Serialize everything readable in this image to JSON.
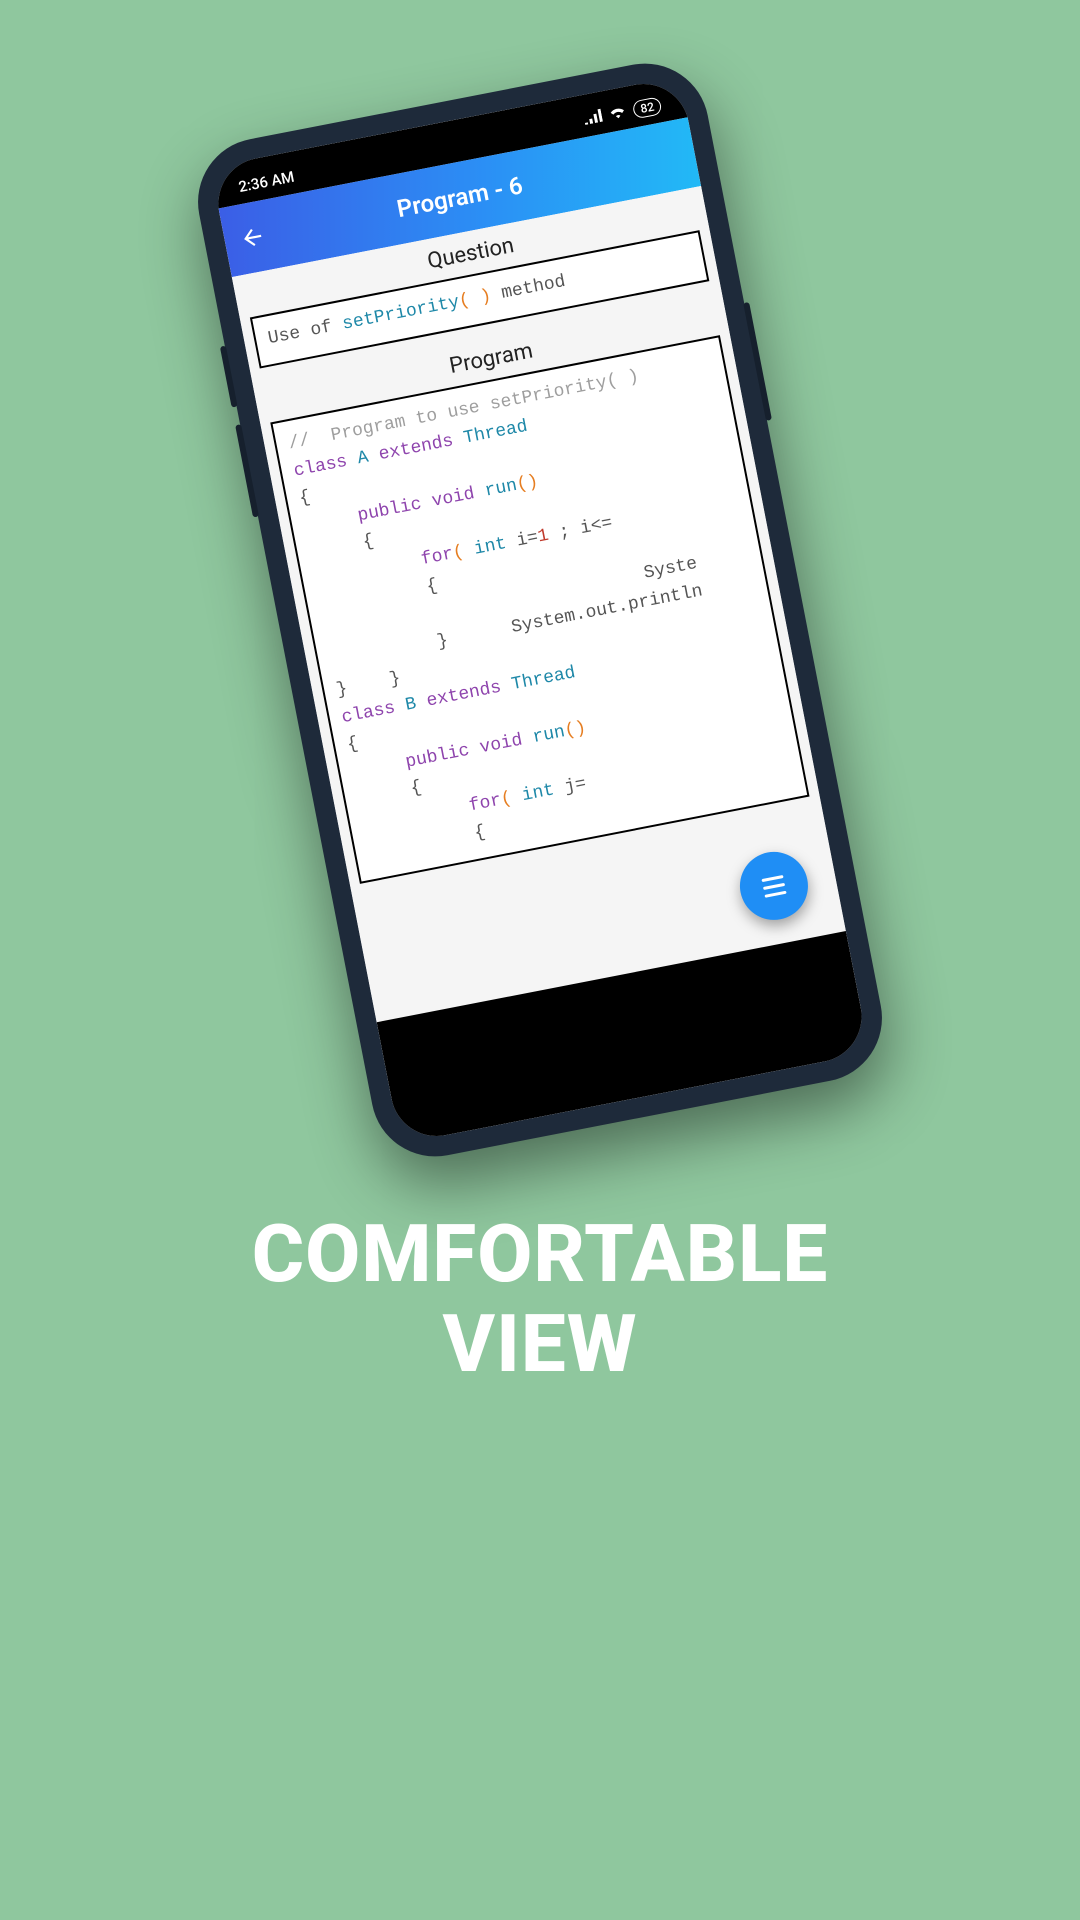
{
  "status": {
    "time": "2:36 AM",
    "battery": "82"
  },
  "appbar": {
    "title": "Program - 6"
  },
  "labels": {
    "question": "Question",
    "program": "Program"
  },
  "question": {
    "pre": "Use of ",
    "method": "setPriority",
    "post": " method"
  },
  "code": {
    "comment": "//  Program to use setPriority( )",
    "class_kw": "class",
    "A": "A",
    "B": "B",
    "extends_kw": "extends",
    "thread": "Thread",
    "public_kw": "public",
    "void_kw": "void",
    "run": "run",
    "for_kw": "for",
    "int_kw": "int",
    "i_init": "i=",
    "one": "1",
    "ile": " ; i<=",
    "sysout": "System.out.println",
    "syste": "Syste",
    "jexpr": "j="
  },
  "marketing": {
    "line1": "COMFORTABLE",
    "line2": "VIEW"
  }
}
